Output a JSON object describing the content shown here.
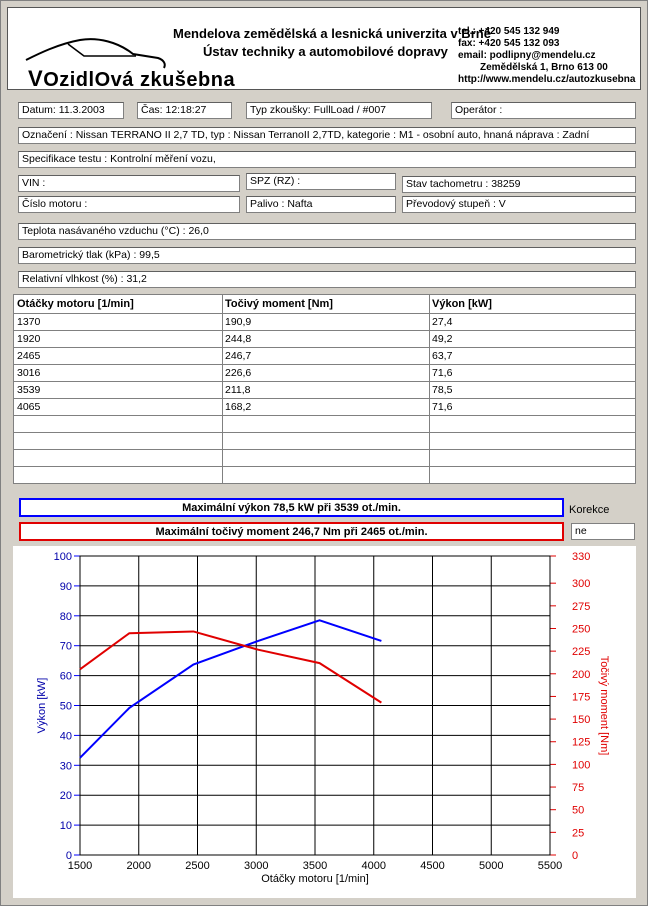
{
  "header": {
    "logo_part1": "V",
    "logo_part2": "OzidlO",
    "logo_part3": "vá zkušebna",
    "university": "Mendelova zemědělská a lesnická univerzita v Brně",
    "institute": "Ústav techniky a automobilové dopravy",
    "tel": "tel.: +420 545 132 949",
    "fax": "fax: +420 545 132 093",
    "email": "email: podlipny@mendelu.cz",
    "address": "Zemědělská 1, Brno 613 00",
    "web": "http://www.mendelu.cz/autozkusebna"
  },
  "fields": {
    "datum": "Datum: 11.3.2003",
    "cas": "Čas: 12:18:27",
    "typ_zkousky": "Typ zkoušky: FullLoad / #007",
    "operator": "Operátor :",
    "oznaceni": "Označení : Nissan TERRANO II 2,7 TD, typ : Nissan TerranoII  2,7TD, kategorie : M1 - osobní auto, hnaná náprava : Zadní",
    "specifikace": "Specifikace testu : Kontrolní měření vozu,",
    "vin": "VIN :",
    "spz": "SPZ (RZ) :",
    "tachometr": "Stav tachometru : 38259",
    "cislo_motoru": "Číslo motoru :",
    "palivo": "Palivo : Nafta",
    "prevodovy_stupen": "Převodový stupeň : V",
    "teplota": "Teplota nasávaného vzduchu (°C) : 26,0",
    "tlak": "Barometrický tlak (kPa) : 99,5",
    "vlhkost": "Relativní vlhkost (%) : 31,2"
  },
  "table": {
    "headers": [
      "Otáčky motoru [1/min]",
      "Točivý moment [Nm]",
      "Výkon [kW]"
    ],
    "rows": [
      [
        "1370",
        "190,9",
        "27,4"
      ],
      [
        "1920",
        "244,8",
        "49,2"
      ],
      [
        "2465",
        "246,7",
        "63,7"
      ],
      [
        "3016",
        "226,6",
        "71,6"
      ],
      [
        "3539",
        "211,8",
        "78,5"
      ],
      [
        "4065",
        "168,2",
        "71,6"
      ]
    ]
  },
  "summary": {
    "max_power": "Maximální výkon 78,5 kW při 3539 ot./min.",
    "max_torque": "Maximální točivý moment 246,7 Nm při 2465 ot./min.",
    "korekce_label": "Korekce",
    "korekce_value": "ne"
  },
  "colors": {
    "power": "#0000ff",
    "torque": "#e00000"
  },
  "chart_data": {
    "type": "line",
    "xlabel": "Otáčky motoru [1/min]",
    "ylabel_left": "Výkon [kW]",
    "ylabel_right": "Točivý moment [Nm]",
    "xlim": [
      1500,
      5500
    ],
    "ylim_left": [
      0,
      100
    ],
    "ylim_right": [
      0,
      330
    ],
    "x_ticks": [
      "1500",
      "2000",
      "2500",
      "3000",
      "3500",
      "4000",
      "4500",
      "5000",
      "5500"
    ],
    "y_ticks_left": [
      "0",
      "10",
      "20",
      "30",
      "40",
      "50",
      "60",
      "70",
      "80",
      "90",
      "100"
    ],
    "y_ticks_right": [
      "0",
      "25",
      "50",
      "75",
      "100",
      "125",
      "150",
      "175",
      "200",
      "225",
      "250",
      "275",
      "300",
      "330"
    ],
    "grid": true,
    "series": [
      {
        "name": "Výkon [kW]",
        "axis": "left",
        "color": "#0000ff",
        "x": [
          1500,
          1920,
          2465,
          3016,
          3539,
          4065
        ],
        "y": [
          32.5,
          49.2,
          63.7,
          71.6,
          78.5,
          71.6
        ]
      },
      {
        "name": "Točivý moment [Nm]",
        "axis": "right",
        "color": "#e00000",
        "x": [
          1500,
          1920,
          2465,
          3016,
          3539,
          4065
        ],
        "y": [
          205,
          244.8,
          246.7,
          226.6,
          211.8,
          168.2
        ]
      }
    ]
  }
}
